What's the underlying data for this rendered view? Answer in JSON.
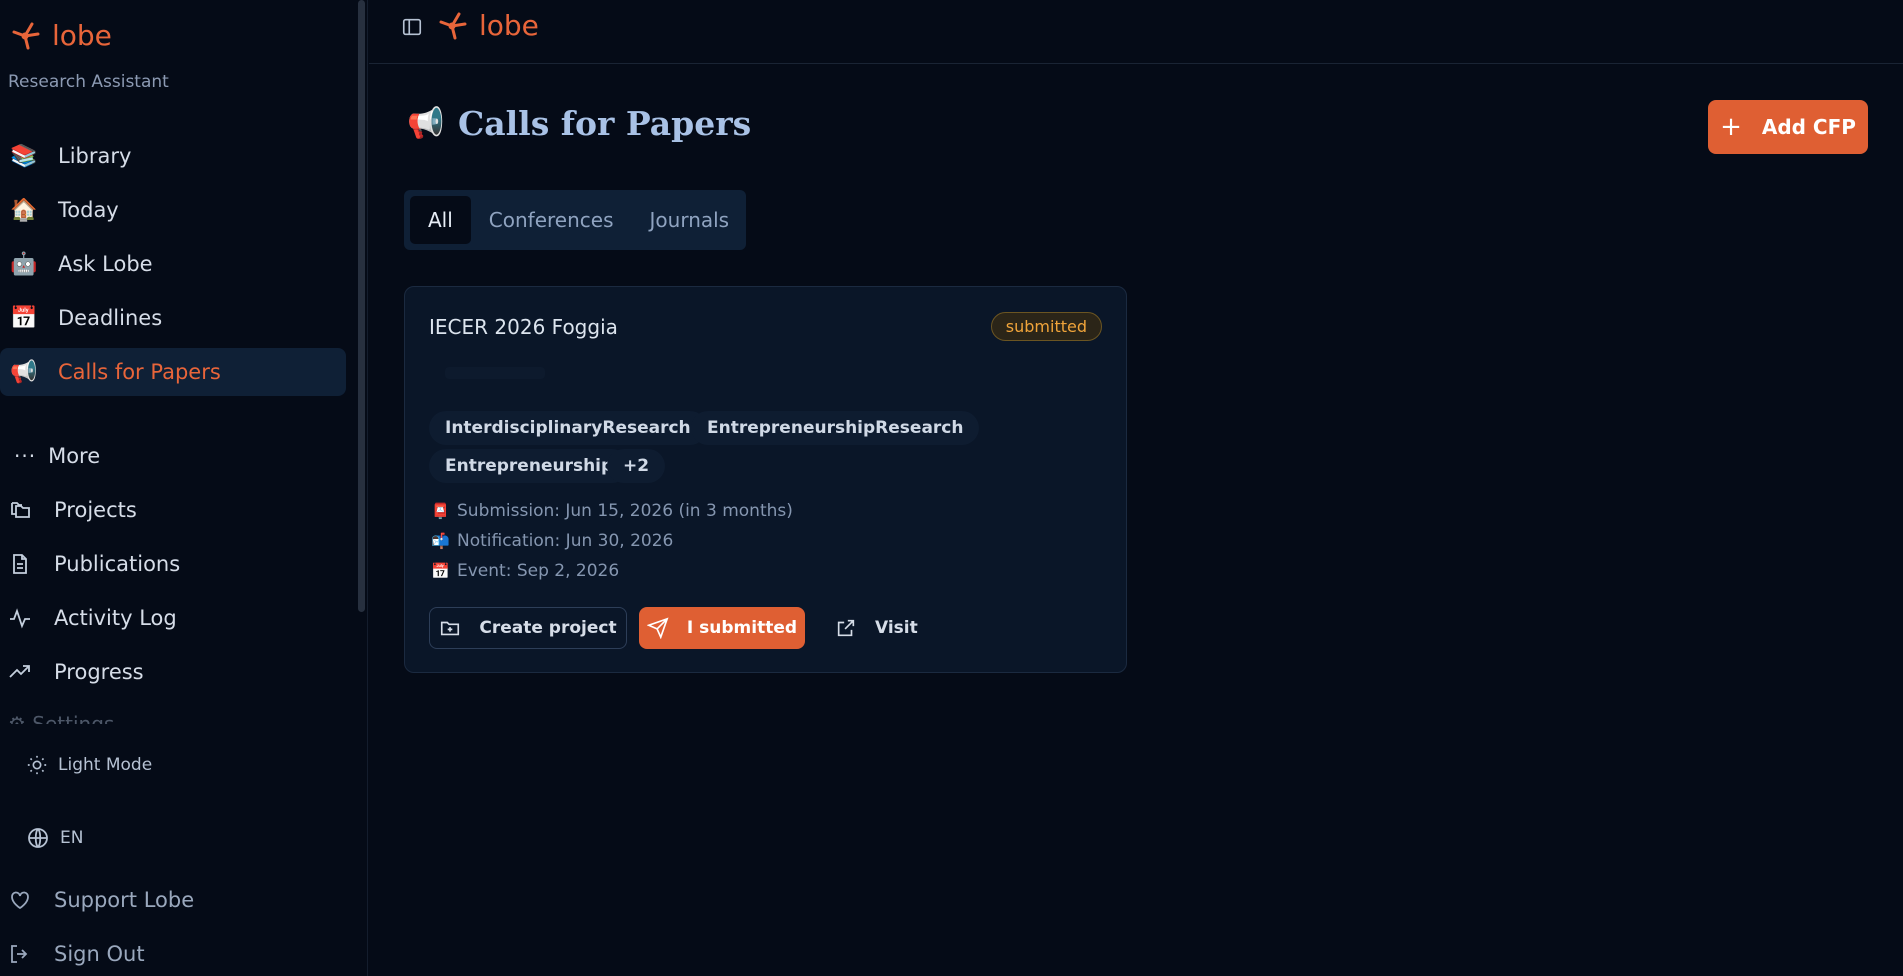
{
  "brand": {
    "name": "lobe",
    "subtitle": "Research Assistant",
    "accent": "#e8653a"
  },
  "sidebar": {
    "items": [
      {
        "label": "Library",
        "icon": "books-icon"
      },
      {
        "label": "Today",
        "icon": "house-icon"
      },
      {
        "label": "Ask Lobe",
        "icon": "robot-icon"
      },
      {
        "label": "Deadlines",
        "icon": "calendar-icon"
      },
      {
        "label": "Calls for Papers",
        "icon": "megaphone-icon",
        "active": true
      }
    ],
    "more_label": "More",
    "secondary": [
      {
        "label": "Projects",
        "icon": "folders-icon"
      },
      {
        "label": "Publications",
        "icon": "document-icon"
      },
      {
        "label": "Activity Log",
        "icon": "activity-icon"
      },
      {
        "label": "Progress",
        "icon": "trending-up-icon"
      }
    ],
    "theme_label": "Light Mode",
    "language_label": "EN",
    "support_label": "Support Lobe",
    "signout_label": "Sign Out"
  },
  "topbar": {
    "brand_name": "lobe"
  },
  "main": {
    "title": "Calls for Papers",
    "add_button": "Add CFP",
    "tabs": [
      {
        "label": "All",
        "active": true
      },
      {
        "label": "Conferences"
      },
      {
        "label": "Journals"
      }
    ]
  },
  "cfp_card": {
    "title": "IECER 2026 Foggia",
    "status": "submitted",
    "tags": [
      "InterdisciplinaryResearch",
      "EntrepreneurshipResearch",
      "Entrepreneurship",
      "+2"
    ],
    "submission": "Submission: Jun 15, 2026 (in 3 months)",
    "notification": "Notification: Jun 30, 2026",
    "event": "Event: Sep 2, 2026",
    "create_project": "Create project",
    "i_submitted": "I submitted",
    "visit": "Visit"
  }
}
